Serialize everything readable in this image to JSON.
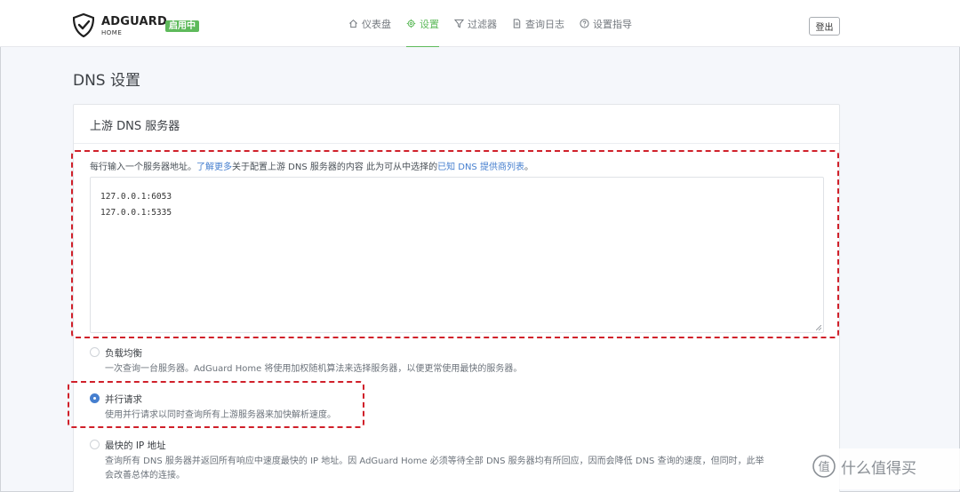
{
  "header": {
    "brand": "ADGUARD",
    "brand_sub": "HOME",
    "status_badge": "启用中",
    "nav": [
      {
        "label": "仪表盘",
        "icon": "home-icon"
      },
      {
        "label": "设置",
        "icon": "gear-icon",
        "active": true
      },
      {
        "label": "过滤器",
        "icon": "filter-icon"
      },
      {
        "label": "查询日志",
        "icon": "document-icon"
      },
      {
        "label": "设置指导",
        "icon": "help-icon"
      }
    ],
    "logout_label": "登出"
  },
  "page": {
    "title": "DNS 设置"
  },
  "upstream": {
    "card_title": "上游 DNS 服务器",
    "desc_prefix": "每行输入一个服务器地址。",
    "desc_link1": "了解更多",
    "desc_middle": "关于配置上游 DNS 服务器的内容 此为可从中选择的",
    "desc_link2": "已知 DNS 提供商列表",
    "desc_suffix": "。",
    "servers": [
      "127.0.0.1:6053",
      "127.0.0.1:5335"
    ]
  },
  "modes": {
    "load_balance": {
      "label": "负载均衡",
      "desc": "一次查询一台服务器。AdGuard Home 将使用加权随机算法来选择服务器，以便更常使用最快的服务器。",
      "selected": false
    },
    "parallel": {
      "label": "并行请求",
      "desc": "使用并行请求以同时查询所有上游服务器来加快解析速度。",
      "selected": true
    },
    "fastest": {
      "label": "最快的 IP 地址",
      "desc": "查询所有 DNS 服务器并返回所有响应中速度最快的 IP 地址。因 AdGuard Home 必须等待全部 DNS 服务器均有所回应，因而会降低 DNS 查询的速度，但同时，此举",
      "desc2": "会改善总体的连接。",
      "selected": false
    }
  },
  "watermark": {
    "text": "什么值得买",
    "logo_text": "值"
  },
  "colors": {
    "accent": "#5eba5b",
    "link": "#467fcf",
    "highlight": "#d0202a"
  }
}
